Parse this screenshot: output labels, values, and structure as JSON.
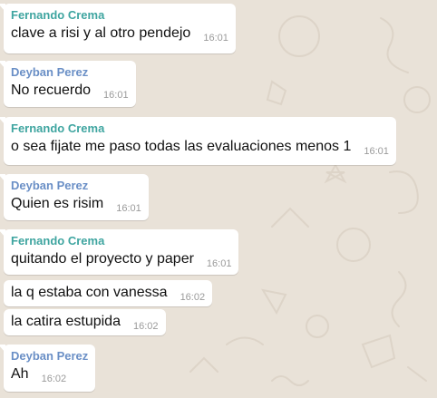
{
  "messages": [
    {
      "sender": "Fernando Crema",
      "text": "clave a risi y al otro pendejo",
      "time": "16:01"
    },
    {
      "sender": "Deyban Perez",
      "text": "No recuerdo",
      "time": "16:01"
    },
    {
      "sender": "Fernando Crema",
      "text": "o sea fijate me paso todas las evaluaciones menos 1",
      "time": "16:01"
    },
    {
      "sender": "Deyban Perez",
      "text": "Quien es risim",
      "time": "16:01"
    },
    {
      "sender": "Fernando Crema",
      "text": "quitando el proyecto y paper",
      "time": "16:01"
    },
    {
      "sender": "",
      "text": "la q estaba con vanessa",
      "time": "16:02"
    },
    {
      "sender": "",
      "text": "la catira estupida",
      "time": "16:02"
    },
    {
      "sender": "Deyban Perez",
      "text": "Ah",
      "time": "16:02"
    }
  ],
  "colors": {
    "wallpaper": "#e9e2d8",
    "bubble": "#ffffff",
    "fernando_name": "#3fa5a0",
    "deyban_name": "#6a8fc6",
    "timestamp": "#9a9a9a"
  }
}
